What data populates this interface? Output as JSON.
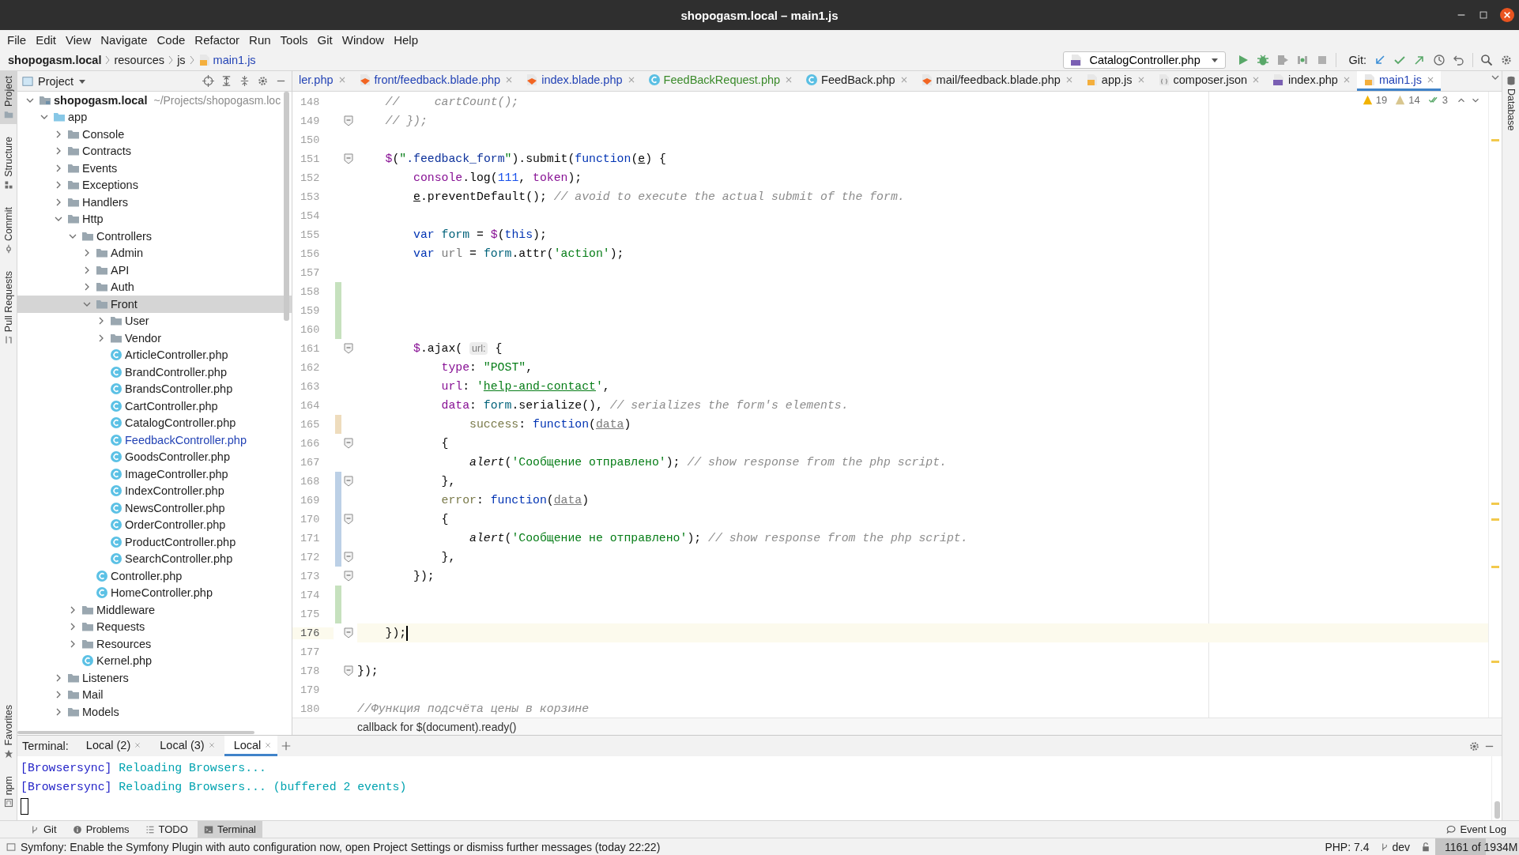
{
  "window": {
    "title": "shopogasm.local – main1.js"
  },
  "menu": [
    "File",
    "Edit",
    "View",
    "Navigate",
    "Code",
    "Refactor",
    "Run",
    "Tools",
    "Git",
    "Window",
    "Help"
  ],
  "breadcrumb": [
    {
      "text": "shopogasm.local",
      "kind": "project"
    },
    {
      "text": "resources",
      "kind": "folder"
    },
    {
      "text": "js",
      "kind": "folder"
    },
    {
      "text": "main1.js",
      "kind": "js"
    }
  ],
  "run_config": {
    "label": "CatalogController.php"
  },
  "git_label": "Git:",
  "left_strip": [
    {
      "label": "Project",
      "selected": true
    },
    {
      "label": "Structure",
      "selected": false
    },
    {
      "label": "Commit",
      "selected": false
    },
    {
      "label": "Pull Requests",
      "selected": false
    }
  ],
  "left_strip_bottom": [
    {
      "label": "Favorites",
      "selected": false
    },
    {
      "label": "npm",
      "selected": false
    }
  ],
  "right_strip": [
    {
      "label": "Database",
      "selected": false
    }
  ],
  "project": {
    "title": "Project",
    "tree": [
      {
        "name": "shopogasm.local",
        "path": "~/Projects/shopogasm.loc",
        "kind": "module",
        "expanded": true,
        "selected": false,
        "children": [
          {
            "name": "app",
            "kind": "source",
            "expanded": true,
            "selected": false,
            "children": [
              {
                "name": "Console",
                "kind": "folder",
                "expanded": false,
                "selected": false
              },
              {
                "name": "Contracts",
                "kind": "folder",
                "expanded": false,
                "selected": false
              },
              {
                "name": "Events",
                "kind": "folder",
                "expanded": false,
                "selected": false
              },
              {
                "name": "Exceptions",
                "kind": "folder",
                "expanded": false,
                "selected": false
              },
              {
                "name": "Handlers",
                "kind": "folder",
                "expanded": false,
                "selected": false
              },
              {
                "name": "Http",
                "kind": "folder",
                "expanded": true,
                "selected": false,
                "children": [
                  {
                    "name": "Controllers",
                    "kind": "folder",
                    "expanded": true,
                    "selected": false,
                    "children": [
                      {
                        "name": "Admin",
                        "kind": "folder",
                        "expanded": false,
                        "selected": false
                      },
                      {
                        "name": "API",
                        "kind": "folder",
                        "expanded": false,
                        "selected": false
                      },
                      {
                        "name": "Auth",
                        "kind": "folder",
                        "expanded": false,
                        "selected": false
                      },
                      {
                        "name": "Front",
                        "kind": "folder",
                        "expanded": true,
                        "selected": true,
                        "children": [
                          {
                            "name": "User",
                            "kind": "folder",
                            "expanded": false,
                            "selected": false
                          },
                          {
                            "name": "Vendor",
                            "kind": "folder",
                            "expanded": false,
                            "selected": false
                          },
                          {
                            "name": "ArticleController.php",
                            "kind": "class",
                            "selected": false
                          },
                          {
                            "name": "BrandController.php",
                            "kind": "class",
                            "selected": false
                          },
                          {
                            "name": "BrandsController.php",
                            "kind": "class",
                            "selected": false
                          },
                          {
                            "name": "CartController.php",
                            "kind": "class",
                            "selected": false
                          },
                          {
                            "name": "CatalogController.php",
                            "kind": "class",
                            "selected": false
                          },
                          {
                            "name": "FeedbackController.php",
                            "kind": "class",
                            "selected": false,
                            "color": "#2343b5"
                          },
                          {
                            "name": "GoodsController.php",
                            "kind": "class",
                            "selected": false
                          },
                          {
                            "name": "ImageController.php",
                            "kind": "class",
                            "selected": false
                          },
                          {
                            "name": "IndexController.php",
                            "kind": "class",
                            "selected": false
                          },
                          {
                            "name": "NewsController.php",
                            "kind": "class",
                            "selected": false
                          },
                          {
                            "name": "OrderController.php",
                            "kind": "class",
                            "selected": false
                          },
                          {
                            "name": "ProductController.php",
                            "kind": "class",
                            "selected": false
                          },
                          {
                            "name": "SearchController.php",
                            "kind": "class",
                            "selected": false
                          }
                        ]
                      },
                      {
                        "name": "Controller.php",
                        "kind": "class",
                        "selected": false
                      },
                      {
                        "name": "HomeController.php",
                        "kind": "class",
                        "selected": false
                      }
                    ]
                  },
                  {
                    "name": "Middleware",
                    "kind": "folder",
                    "expanded": false,
                    "selected": false
                  },
                  {
                    "name": "Requests",
                    "kind": "folder",
                    "expanded": false,
                    "selected": false
                  },
                  {
                    "name": "Resources",
                    "kind": "folder",
                    "expanded": false,
                    "selected": false
                  },
                  {
                    "name": "Kernel.php",
                    "kind": "class",
                    "selected": false
                  }
                ]
              },
              {
                "name": "Listeners",
                "kind": "folder",
                "expanded": false,
                "selected": false
              },
              {
                "name": "Mail",
                "kind": "folder",
                "expanded": false,
                "selected": false
              },
              {
                "name": "Models",
                "kind": "folder",
                "expanded": false,
                "selected": false
              }
            ]
          }
        ]
      }
    ]
  },
  "tabs": [
    {
      "label": "ler.php",
      "color": "#2343b5",
      "selected": false
    },
    {
      "label": "front/feedback.blade.php",
      "kind": "blade",
      "color": "#2343b5",
      "selected": false
    },
    {
      "label": "index.blade.php",
      "kind": "blade",
      "color": "#2343b5",
      "selected": false
    },
    {
      "label": "FeedBackRequest.php",
      "kind": "class",
      "color": "#3a8a2a",
      "selected": false
    },
    {
      "label": "FeedBack.php",
      "kind": "class",
      "color": "#1e1e1e",
      "selected": false
    },
    {
      "label": "mail/feedback.blade.php",
      "kind": "blade",
      "color": "#1e1e1e",
      "selected": false
    },
    {
      "label": "app.js",
      "kind": "js",
      "color": "#1e1e1e",
      "selected": false
    },
    {
      "label": "composer.json",
      "kind": "json",
      "color": "#1e1e1e",
      "selected": false
    },
    {
      "label": "index.php",
      "kind": "php",
      "color": "#1e1e1e",
      "selected": false
    },
    {
      "label": "main1.js",
      "kind": "js",
      "color": "#2343b5",
      "selected": true
    }
  ],
  "inspections": {
    "warnings": "19",
    "weak_warnings": "14",
    "passed": "3"
  },
  "code": [
    {
      "number": "148",
      "fold": false,
      "current": false,
      "tokens": [
        {
          "kind": "comment",
          "text": "    //     cartCount();"
        }
      ]
    },
    {
      "number": "149",
      "fold": true,
      "current": false,
      "tokens": [
        {
          "kind": "comment",
          "text": "    // });"
        }
      ]
    },
    {
      "number": "150",
      "fold": false,
      "current": false
    },
    {
      "number": "151",
      "fold": true,
      "current": false,
      "tokens": [
        {
          "kind": "global",
          "text": "    $"
        },
        {
          "kind": "plain",
          "text": "("
        },
        {
          "kind": "string",
          "text": "\""
        },
        {
          "kind": "selector",
          "text": ".feedback_form"
        },
        {
          "kind": "string",
          "text": "\""
        },
        {
          "kind": "plain",
          "text": ").submit("
        },
        {
          "kind": "keyword",
          "text": "function"
        },
        {
          "kind": "plain",
          "text": "("
        },
        {
          "kind": "param",
          "text": "e"
        },
        {
          "kind": "plain",
          "text": ") {"
        }
      ]
    },
    {
      "number": "152",
      "fold": false,
      "current": false,
      "tokens": [
        {
          "kind": "global",
          "text": "        console"
        },
        {
          "kind": "plain",
          "text": ".log("
        },
        {
          "kind": "number",
          "text": "111"
        },
        {
          "kind": "plain",
          "text": ", "
        },
        {
          "kind": "global",
          "text": "token"
        },
        {
          "kind": "plain",
          "text": ");"
        }
      ]
    },
    {
      "number": "153",
      "fold": false,
      "current": false,
      "tokens": [
        {
          "kind": "param",
          "text": "        e"
        },
        {
          "kind": "plain",
          "text": ".preventDefault(); "
        },
        {
          "kind": "comment",
          "text": "// avoid to execute the actual submit of the form."
        }
      ]
    },
    {
      "number": "154",
      "fold": false,
      "current": false
    },
    {
      "number": "155",
      "fold": false,
      "current": false,
      "tokens": [
        {
          "kind": "keyword",
          "text": "        var"
        },
        {
          "kind": "local",
          "text": " form"
        },
        {
          "kind": "plain",
          "text": " = "
        },
        {
          "kind": "global",
          "text": "$"
        },
        {
          "kind": "plain",
          "text": "("
        },
        {
          "kind": "keyword",
          "text": "this"
        },
        {
          "kind": "plain",
          "text": ");"
        }
      ]
    },
    {
      "number": "156",
      "fold": false,
      "current": false,
      "tokens": [
        {
          "kind": "keyword",
          "text": "        var"
        },
        {
          "kind": "unused",
          "text": " url"
        },
        {
          "kind": "plain",
          "text": " = "
        },
        {
          "kind": "local",
          "text": "form"
        },
        {
          "kind": "plain",
          "text": ".attr("
        },
        {
          "kind": "string",
          "text": "'action'"
        },
        {
          "kind": "plain",
          "text": ");"
        }
      ]
    },
    {
      "number": "157",
      "fold": false,
      "current": false
    },
    {
      "number": "158",
      "fold": false,
      "current": false,
      "color": "#c6e1be"
    },
    {
      "number": "159",
      "fold": false,
      "current": false,
      "color": "#c6e1be"
    },
    {
      "number": "160",
      "fold": false,
      "current": false,
      "color": "#c6e1be"
    },
    {
      "number": "161",
      "fold": true,
      "current": false,
      "tokens": [
        {
          "kind": "global",
          "text": "        $"
        },
        {
          "kind": "plain",
          "text": ".ajax( "
        },
        {
          "kind": "hint",
          "text": "url:"
        },
        {
          "kind": "plain",
          "text": " {"
        }
      ]
    },
    {
      "number": "162",
      "fold": false,
      "current": false,
      "tokens": [
        {
          "kind": "global",
          "text": "            type"
        },
        {
          "kind": "plain",
          "text": ": "
        },
        {
          "kind": "string",
          "text": "\"POST\""
        },
        {
          "kind": "plain",
          "text": ","
        }
      ]
    },
    {
      "number": "163",
      "fold": false,
      "current": false,
      "tokens": [
        {
          "kind": "global",
          "text": "            url"
        },
        {
          "kind": "plain",
          "text": ": "
        },
        {
          "kind": "string",
          "text": "'"
        },
        {
          "kind": "link",
          "text": "help-and-contact"
        },
        {
          "kind": "string",
          "text": "'"
        },
        {
          "kind": "plain",
          "text": ","
        }
      ]
    },
    {
      "number": "164",
      "fold": false,
      "current": false,
      "tokens": [
        {
          "kind": "global",
          "text": "            data"
        },
        {
          "kind": "plain",
          "text": ": "
        },
        {
          "kind": "local",
          "text": "form"
        },
        {
          "kind": "plain",
          "text": ".serialize(), "
        },
        {
          "kind": "comment",
          "text": "// serializes the form's elements."
        }
      ]
    },
    {
      "number": "165",
      "fold": false,
      "current": false,
      "color": "#eedcbd",
      "tokens": [
        {
          "kind": "dim",
          "text": "                success"
        },
        {
          "kind": "plain",
          "text": ": "
        },
        {
          "kind": "keyword",
          "text": "function"
        },
        {
          "kind": "plain",
          "text": "("
        },
        {
          "kind": "unused_param",
          "text": "data"
        },
        {
          "kind": "plain",
          "text": ")"
        }
      ]
    },
    {
      "number": "166",
      "fold": true,
      "current": false,
      "tokens": [
        {
          "kind": "plain",
          "text": "            {"
        }
      ]
    },
    {
      "number": "167",
      "fold": false,
      "current": false,
      "tokens": [
        {
          "kind": "italic",
          "text": "                alert"
        },
        {
          "kind": "plain",
          "text": "("
        },
        {
          "kind": "string",
          "text": "'Сообщение отправлено'"
        },
        {
          "kind": "plain",
          "text": "); "
        },
        {
          "kind": "comment",
          "text": "// show response from the php script."
        }
      ]
    },
    {
      "number": "168",
      "fold": true,
      "current": false,
      "color": "#bcd0e6",
      "tokens": [
        {
          "kind": "plain",
          "text": "            },"
        }
      ]
    },
    {
      "number": "169",
      "fold": false,
      "current": false,
      "color": "#bcd0e6",
      "tokens": [
        {
          "kind": "dim",
          "text": "            error"
        },
        {
          "kind": "plain",
          "text": ": "
        },
        {
          "kind": "keyword",
          "text": "function"
        },
        {
          "kind": "plain",
          "text": "("
        },
        {
          "kind": "unused_param",
          "text": "data"
        },
        {
          "kind": "plain",
          "text": ")"
        }
      ]
    },
    {
      "number": "170",
      "fold": true,
      "current": false,
      "color": "#bcd0e6",
      "tokens": [
        {
          "kind": "plain",
          "text": "            {"
        }
      ]
    },
    {
      "number": "171",
      "fold": false,
      "current": false,
      "color": "#bcd0e6",
      "tokens": [
        {
          "kind": "italic",
          "text": "                alert"
        },
        {
          "kind": "plain",
          "text": "("
        },
        {
          "kind": "string",
          "text": "'Сообщение не отправлено'"
        },
        {
          "kind": "plain",
          "text": "); "
        },
        {
          "kind": "comment",
          "text": "// show response from the php script."
        }
      ]
    },
    {
      "number": "172",
      "fold": true,
      "current": false,
      "color": "#bcd0e6",
      "tokens": [
        {
          "kind": "plain",
          "text": "            },"
        }
      ]
    },
    {
      "number": "173",
      "fold": true,
      "current": false,
      "tokens": [
        {
          "kind": "plain",
          "text": "        });"
        }
      ]
    },
    {
      "number": "174",
      "fold": false,
      "current": false,
      "color": "#c6e1be"
    },
    {
      "number": "175",
      "fold": false,
      "current": false,
      "color": "#c6e1be"
    },
    {
      "number": "176",
      "fold": true,
      "current": true,
      "tokens": [
        {
          "kind": "plain",
          "text": "    });"
        }
      ]
    },
    {
      "number": "177",
      "fold": false,
      "current": false
    },
    {
      "number": "178",
      "fold": true,
      "current": false,
      "tokens": [
        {
          "kind": "plain",
          "text": "});"
        }
      ]
    },
    {
      "number": "179",
      "fold": false,
      "current": false
    },
    {
      "number": "180",
      "fold": false,
      "current": false,
      "tokens": [
        {
          "kind": "comment",
          "text": "//Функция подсчёта цены в корзине"
        }
      ]
    }
  ],
  "editor_breadcrumb": "callback for $(document).ready()",
  "terminal": {
    "label": "Terminal:",
    "tabs": [
      {
        "label": "Local (2)",
        "selected": false
      },
      {
        "label": "Local (3)",
        "selected": false
      },
      {
        "label": "Local",
        "selected": true
      }
    ],
    "lines": [
      [
        {
          "kind": "tag",
          "text": "[Browsersync]"
        },
        {
          "kind": "output",
          "text": " Reloading Browsers..."
        }
      ],
      [
        {
          "kind": "tag",
          "text": "[Browsersync]"
        },
        {
          "kind": "output",
          "text": " Reloading Browsers... (buffered 2 events)"
        }
      ]
    ]
  },
  "tool_windows": [
    {
      "label": "Git",
      "kind": "git",
      "selected": false
    },
    {
      "label": "Problems",
      "kind": "problems",
      "selected": false
    },
    {
      "label": "TODO",
      "kind": "todo",
      "selected": false
    },
    {
      "label": "Terminal",
      "kind": "terminal",
      "selected": true
    }
  ],
  "event_log": "Event Log",
  "status": {
    "message": "Symfony: Enable the Symfony Plugin with auto configuration now, open Project Settings or dismiss further messages (today 22:22)",
    "php": "PHP: 7.4",
    "branch": "dev",
    "memory": {
      "text": "1161 of 1934M",
      "level": 0.6
    }
  }
}
